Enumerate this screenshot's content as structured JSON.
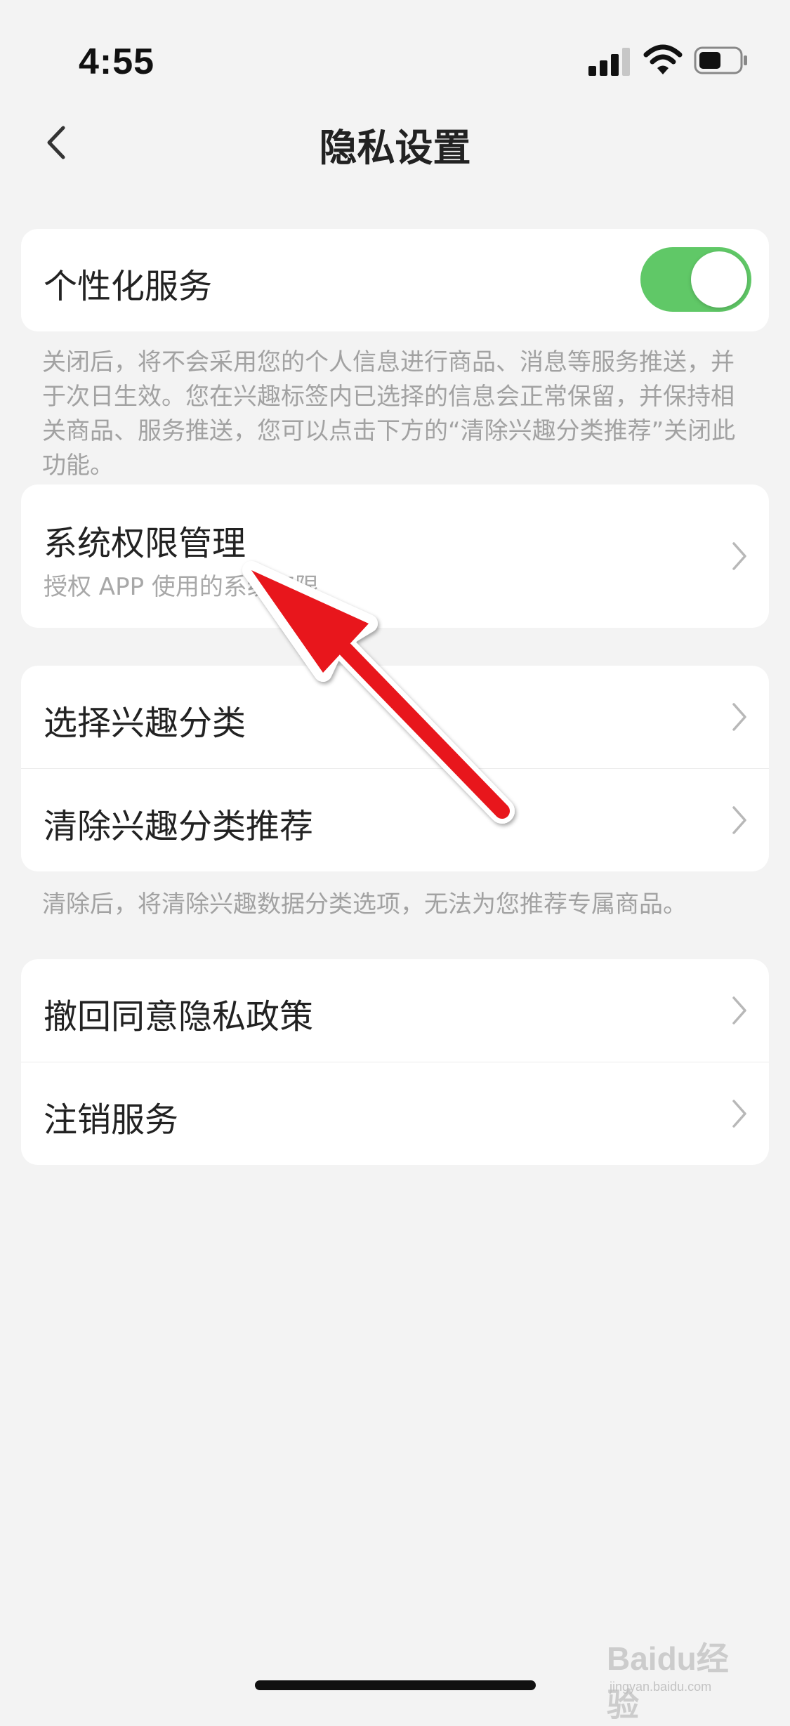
{
  "status_bar": {
    "time": "4:55",
    "icons": [
      "signal-icon",
      "wifi-icon",
      "battery-icon"
    ]
  },
  "nav": {
    "back_icon": "back-chevron-icon",
    "title": "隐私设置"
  },
  "personalized": {
    "label": "个性化服务",
    "toggle_on": true,
    "toggle_color": "#60c867",
    "note": "关闭后，将不会采用您的个人信息进行商品、消息等服务推送，并于次日生效。您在兴趣标签内已选择的信息会正常保留，并保持相关商品、服务推送，您可以点击下方的“清除兴趣分类推荐”关闭此功能。"
  },
  "permissions": {
    "title": "系统权限管理",
    "subtitle": "授权 APP 使用的系统权限"
  },
  "interest": {
    "items": [
      {
        "label": "选择兴趣分类"
      },
      {
        "label": "清除兴趣分类推荐"
      }
    ],
    "note": "清除后，将清除兴趣数据分类选项，无法为您推荐专属商品。"
  },
  "account": {
    "items": [
      {
        "label": "撤回同意隐私政策"
      },
      {
        "label": "注销服务"
      }
    ]
  },
  "annotation": {
    "arrow_color": "#e8141c"
  },
  "watermark": {
    "text": "Baidu经验",
    "sub": "jingyan.baidu.com"
  }
}
